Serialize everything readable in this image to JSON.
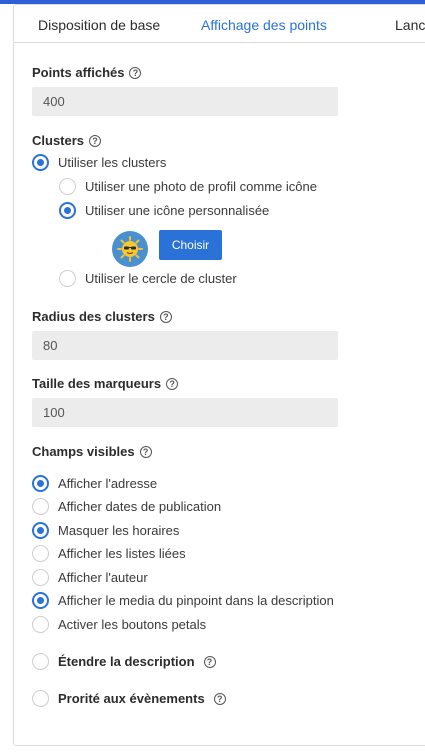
{
  "tabs": [
    "Disposition de base",
    "Affichage des points",
    "Lance"
  ],
  "points": {
    "label": "Points affichés",
    "value": "400"
  },
  "clusters": {
    "label": "Clusters",
    "use_clusters": "Utiliser les clusters",
    "options": [
      "Utiliser une photo de profil comme icône",
      "Utiliser une icône personnalisée"
    ],
    "choose_button": "Choisir",
    "cluster_circle": "Utiliser le cercle de cluster"
  },
  "radius": {
    "label": "Radius des clusters",
    "value": "80"
  },
  "marker_size": {
    "label": "Taille des marqueurs",
    "value": "100"
  },
  "visible_fields": {
    "label": "Champs visibles",
    "items": [
      "Afficher l'adresse",
      "Afficher dates de publication",
      "Masquer les horaires",
      "Afficher les listes liées",
      "Afficher l'auteur",
      "Afficher le media du pinpoint dans la description",
      "Activer les boutons petals"
    ],
    "checked": [
      true,
      false,
      true,
      false,
      false,
      true,
      false
    ]
  },
  "extend_description": "Étendre la description",
  "events_priority": "Prorité aux évènements",
  "colors": {
    "accent": "#2a72d8",
    "field_bg": "#ececec",
    "border": "#dcdcdc"
  },
  "icons": {
    "help": "question-circle-icon",
    "cluster": "sun-sunglasses-icon"
  }
}
